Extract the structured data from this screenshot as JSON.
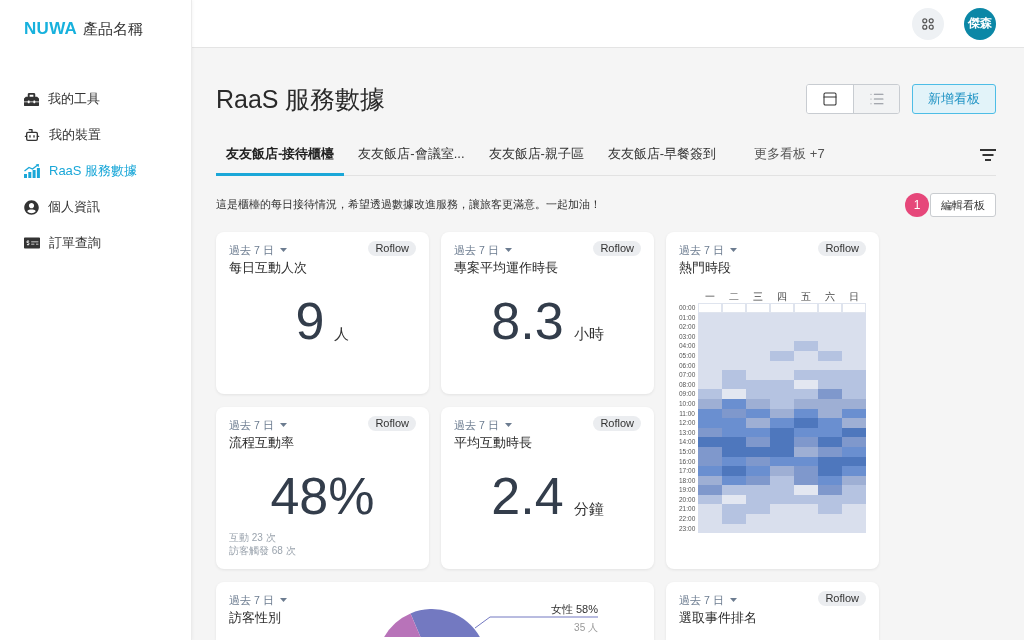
{
  "sidebar": {
    "logo": {
      "wordmark": "NUWA",
      "product": "產品名稱"
    },
    "items": [
      {
        "kind": "toolbox",
        "label": "我的工具",
        "selected": false
      },
      {
        "kind": "robot",
        "label": "我的裝置",
        "selected": false
      },
      {
        "kind": "chart",
        "label": "RaaS 服務數據",
        "selected": true
      },
      {
        "kind": "user",
        "label": "個人資訊",
        "selected": false
      },
      {
        "kind": "order",
        "label": "訂單查詢",
        "selected": false
      }
    ]
  },
  "header": {
    "avatar": "傑森"
  },
  "page": {
    "title": "RaaS 服務數據",
    "view_toggle": [
      {
        "kind": "card",
        "selected": true
      },
      {
        "kind": "list",
        "selected": false
      }
    ],
    "add_button": "新增看板"
  },
  "tabs": [
    {
      "kind": "board",
      "label": "友友飯店-接待櫃檯",
      "selected": true
    },
    {
      "kind": "board",
      "label": "友友飯店-會議室...",
      "selected": false
    },
    {
      "kind": "board",
      "label": "友友飯店-親子區",
      "selected": false
    },
    {
      "kind": "board",
      "label": "友友飯店-早餐簽到",
      "selected": false
    },
    {
      "kind": "more",
      "label": "更多看板 +7",
      "selected": false
    }
  ],
  "description": "這是櫃檯的每日接待情況，希望透過數據改進服務，讓旅客更滿意。一起加油！",
  "edit": {
    "badge": "1",
    "label": "編輯看板"
  },
  "cards": [
    {
      "kind": "metric",
      "range": "過去 7 日",
      "source": "Roflow",
      "title": "每日互動人次",
      "value": "9",
      "unit": "人"
    },
    {
      "kind": "metric",
      "range": "過去 7 日",
      "source": "Roflow",
      "title": "專案平均運作時長",
      "value": "8.3",
      "unit": "小時"
    },
    {
      "kind": "heatmap",
      "range": "過去 7 日",
      "source": "Roflow",
      "title": "熱門時段",
      "days": [
        "一",
        "二",
        "三",
        "四",
        "五",
        "六",
        "日"
      ],
      "hours": [
        "00:00",
        "01:00",
        "02:00",
        "03:00",
        "04:00",
        "05:00",
        "06:00",
        "07:00",
        "08:00",
        "09:00",
        "10:00",
        "11:00",
        "12:00",
        "13:00",
        "14:00",
        "15:00",
        "16:00",
        "17:00",
        "18:00",
        "19:00",
        "20:00",
        "21:00",
        "22:00",
        "23:00"
      ]
    },
    {
      "kind": "metric",
      "range": "過去 7 日",
      "source": "Roflow",
      "title": "流程互動率",
      "value": "48%",
      "notes": [
        "互動 23 次",
        "訪客觸發 68 次"
      ]
    },
    {
      "kind": "metric",
      "range": "過去 7 日",
      "source": "Roflow",
      "title": "平均互動時長",
      "value": "2.4",
      "unit": "分鐘"
    },
    {
      "kind": "pie",
      "range": "過去 7 日",
      "title": "訪客性別",
      "callouts": [
        {
          "label": "女性 58%",
          "count": "35 人"
        }
      ]
    },
    {
      "kind": "ranking",
      "range": "過去 7 日",
      "source": "Roflow",
      "title": "選取事件排名"
    }
  ]
}
